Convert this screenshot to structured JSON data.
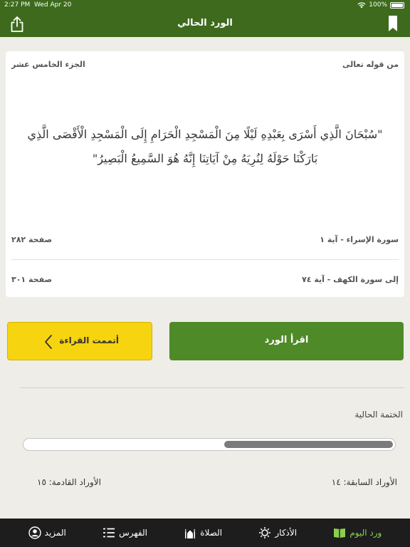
{
  "status": {
    "time": "2:27 PM",
    "date": "Wed Apr 20",
    "battery": "100%"
  },
  "nav": {
    "title": "الورد الحالي",
    "share_icon": "share-icon",
    "bookmark_icon": "bookmark-icon"
  },
  "card": {
    "from_label": "من قوله تعالى",
    "juz": "الجزء الخامس عشر",
    "verse": "\"سُبْحَانَ الَّذِي أَسْرَى بِعَبْدِهِ لَيْلًا مِنَ الْمَسْجِدِ الْحَرَامِ إِلَى الْمَسْجِدِ الْأَقْصَى الَّذِي بَارَكْنَا حَوْلَهُ لِنُرِيَهُ مِنْ آيَاتِنَا إِنَّهُ هُوَ السَّمِيعُ الْبَصِيرُ\"",
    "start_surah": "سورة الإسراء - آية ١",
    "start_page": "صفحة ٢٨٢",
    "end_surah": "إلى سورة الكهف - آية ٧٤",
    "end_page": "صفحة ٣٠١"
  },
  "buttons": {
    "finish": "أتممت القراءة",
    "read": "اقرأ الورد"
  },
  "khatma": {
    "title": "الختمة الحالية",
    "progress": 0.46,
    "previous": "الأوراد السابقة: ١٤",
    "upcoming": "الأوراد القادمة: ١٥"
  },
  "tabs": [
    {
      "label": "ورد اليوم",
      "icon": "book-icon",
      "active": true
    },
    {
      "label": "الأذكار",
      "icon": "sun-icon",
      "active": false
    },
    {
      "label": "الصلاة",
      "icon": "mosque-icon",
      "active": false
    },
    {
      "label": "الفهرس",
      "icon": "list-icon",
      "active": false
    },
    {
      "label": "المزيد",
      "icon": "user-icon",
      "active": false
    }
  ],
  "colors": {
    "primary_green": "#3d6a1c",
    "button_green": "#4f8a29",
    "accent_yellow": "#f6d40f",
    "active_tab": "#8bcf4f"
  }
}
